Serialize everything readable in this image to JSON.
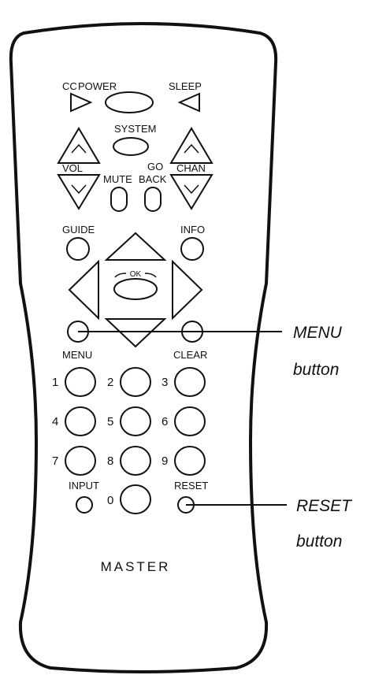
{
  "remote": {
    "labels": {
      "cc": "CC",
      "power": "POWER",
      "sleep": "SLEEP",
      "system": "SYSTEM",
      "vol": "VOL",
      "mute": "MUTE",
      "go_back_1": "GO",
      "go_back_2": "BACK",
      "chan": "CHAN",
      "guide": "GUIDE",
      "info": "INFO",
      "ok": "OK",
      "menu": "MENU",
      "clear": "CLEAR",
      "input": "INPUT",
      "reset": "RESET"
    },
    "digits": [
      "1",
      "2",
      "3",
      "4",
      "5",
      "6",
      "7",
      "8",
      "9",
      "0"
    ],
    "brand": "MASTER"
  },
  "callouts": {
    "menu_line1": "MENU",
    "menu_line2": "button",
    "reset_line1": "RESET",
    "reset_line2": "button"
  }
}
